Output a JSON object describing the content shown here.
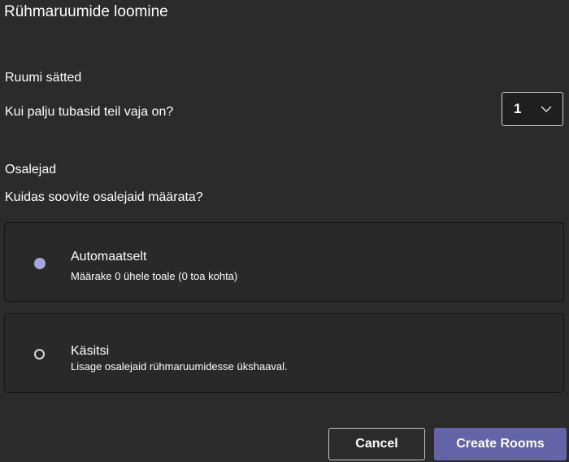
{
  "dialog": {
    "title": "Rühmaruumide loomine"
  },
  "room_settings": {
    "label": "Ruumi sätted",
    "question": "Kui palju tubasid teil vaja on?",
    "count_select": {
      "value": "1",
      "icon": "chevron-down-icon"
    }
  },
  "participants": {
    "label": "Osalejad",
    "question": "Kuidas soovite osalejaid määrata?",
    "options": [
      {
        "title": "Automaatselt",
        "description": "Määrake 0 ühele toale (0 toa kohta)",
        "selected": true
      },
      {
        "title": "Käsitsi",
        "description": "Lisage osalejaid rühmaruumidesse ükshaaval.",
        "selected": false
      }
    ]
  },
  "actions": {
    "cancel_label": "Cancel",
    "create_label": "Create Rooms"
  },
  "colors": {
    "background": "#2b2b2b",
    "accent": "#6264a7",
    "radio_selected": "#a5a6de"
  }
}
